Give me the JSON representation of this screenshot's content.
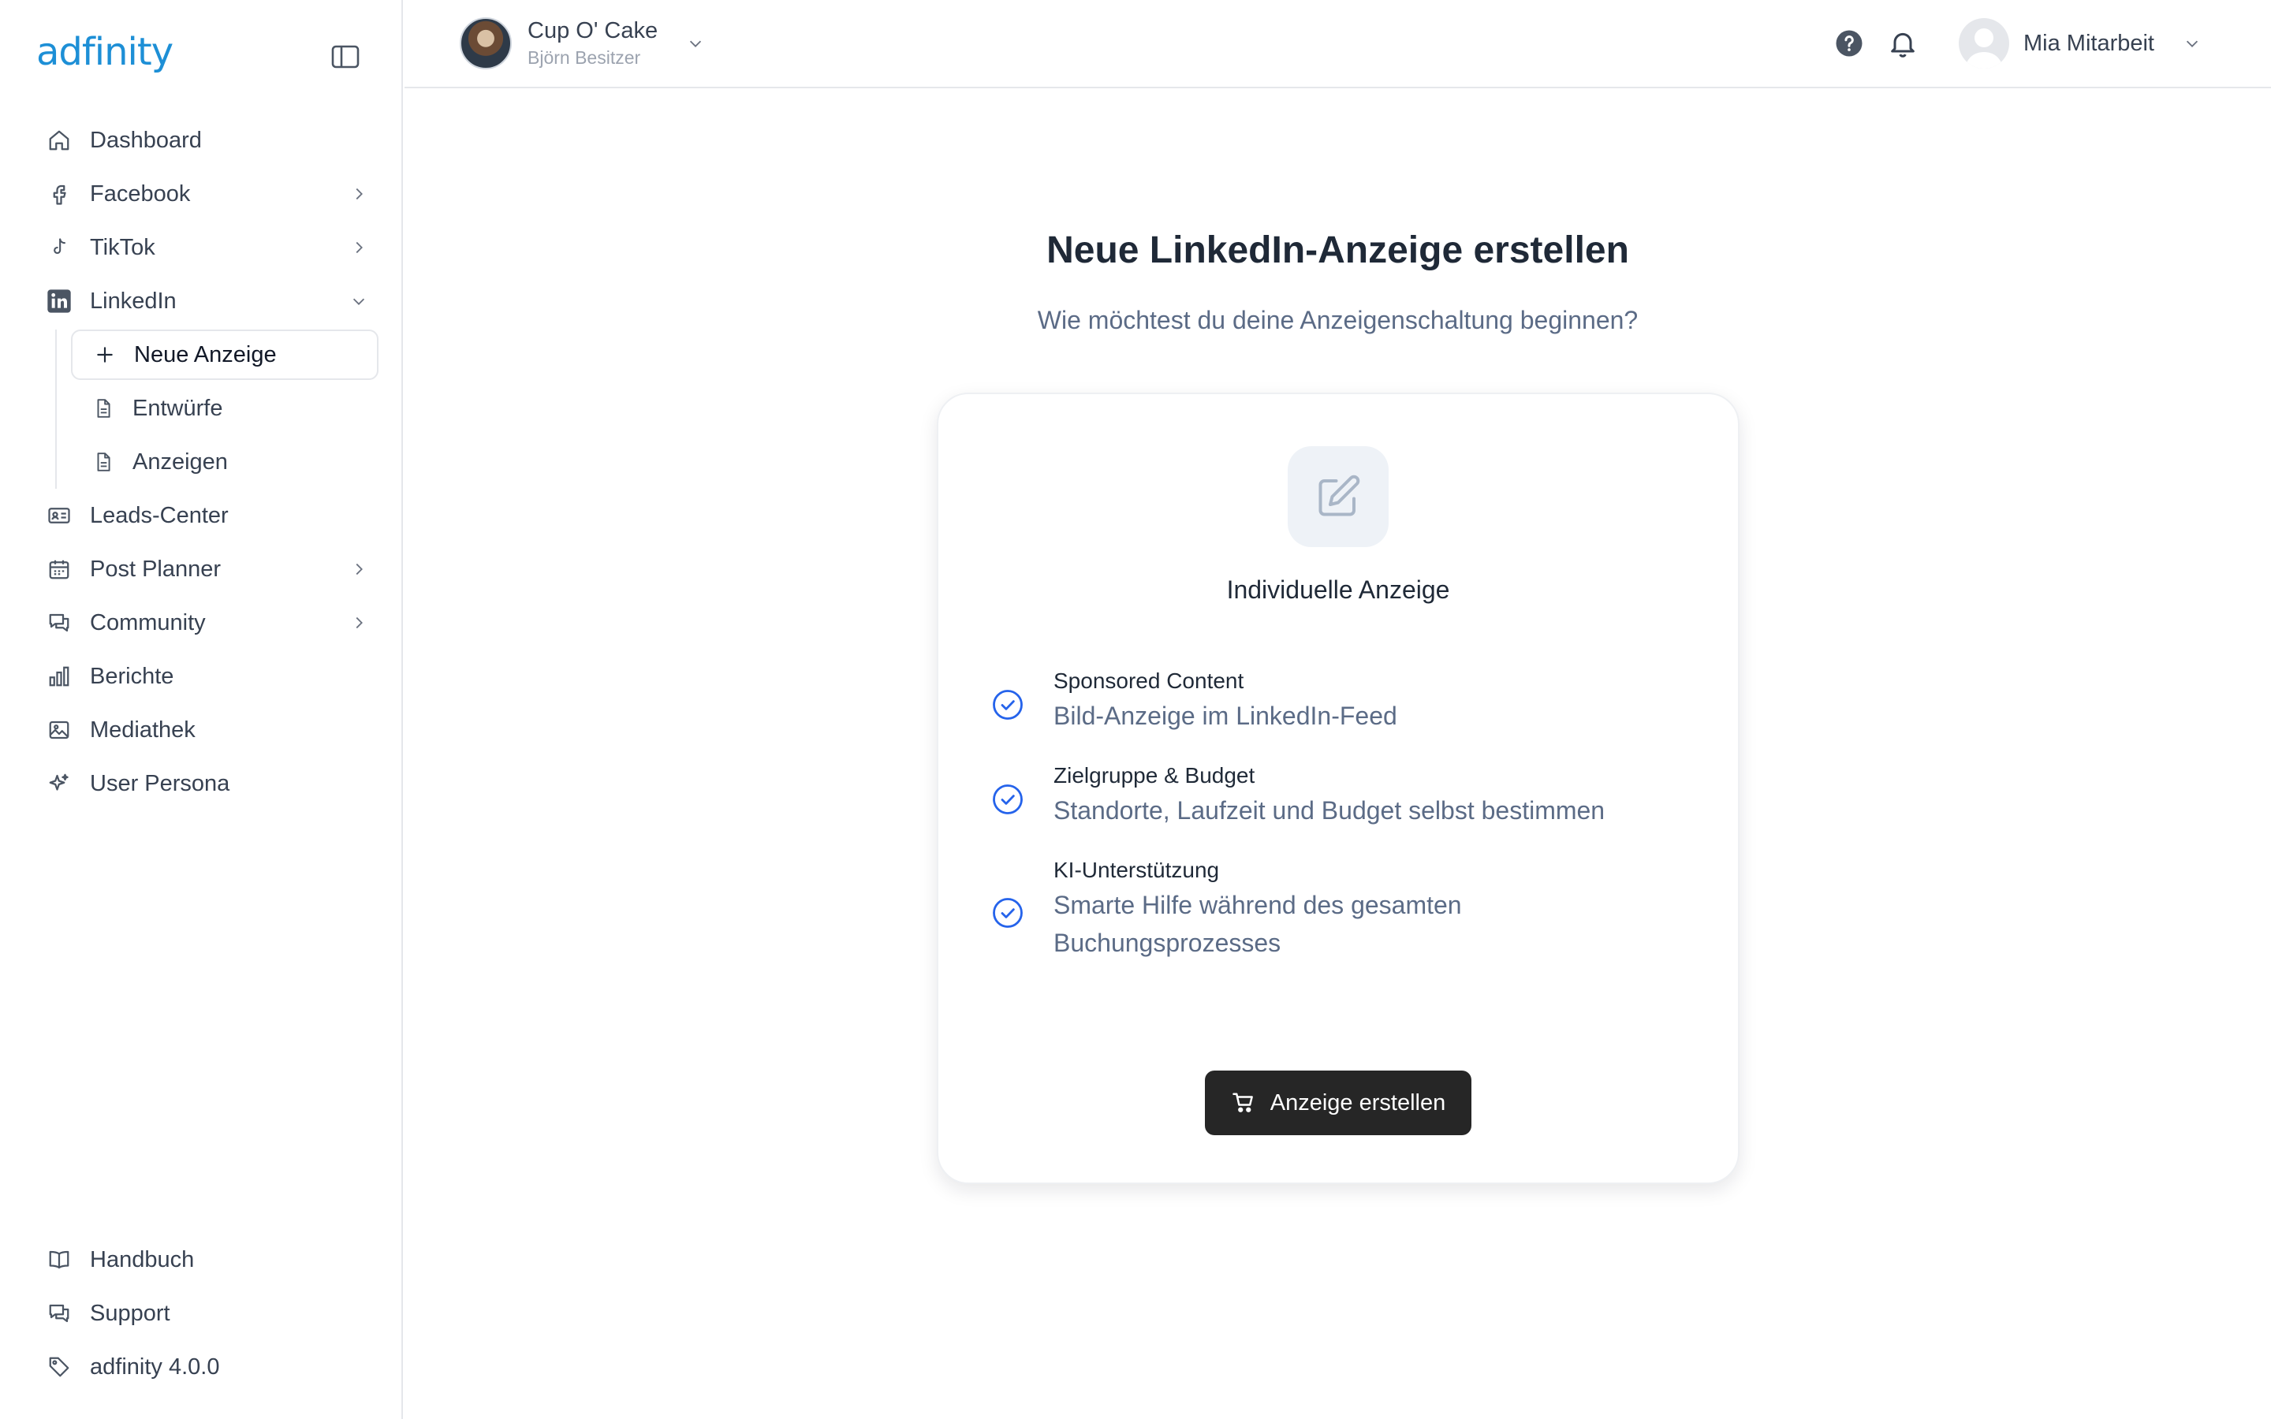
{
  "app": {
    "logo_text": "adfinity"
  },
  "sidebar": {
    "items": [
      {
        "label": "Dashboard",
        "icon": "home-icon"
      },
      {
        "label": "Facebook",
        "icon": "facebook-icon"
      },
      {
        "label": "TikTok",
        "icon": "tiktok-icon"
      },
      {
        "label": "LinkedIn",
        "icon": "linkedin-icon"
      },
      {
        "label": "Leads-Center",
        "icon": "contact-card-icon"
      },
      {
        "label": "Post Planner",
        "icon": "calendar-icon"
      },
      {
        "label": "Community",
        "icon": "chat-icon"
      },
      {
        "label": "Berichte",
        "icon": "bar-chart-icon"
      },
      {
        "label": "Mediathek",
        "icon": "image-icon"
      },
      {
        "label": "User Persona",
        "icon": "sparkles-icon"
      }
    ],
    "linkedin_sub": [
      {
        "label": "Neue Anzeige",
        "icon": "plus-icon",
        "active": true
      },
      {
        "label": "Entwürfe",
        "icon": "document-icon"
      },
      {
        "label": "Anzeigen",
        "icon": "document-icon"
      }
    ],
    "bottom": [
      {
        "label": "Handbuch",
        "icon": "book-icon"
      },
      {
        "label": "Support",
        "icon": "chat-icon"
      },
      {
        "label": "adfinity 4.0.0",
        "icon": "tag-icon"
      }
    ]
  },
  "topbar": {
    "business_name": "Cup O' Cake",
    "business_owner": "Björn Besitzer",
    "user_name": "Mia Mitarbeit"
  },
  "main": {
    "title": "Neue LinkedIn-Anzeige erstellen",
    "subtitle": "Wie möchtest du deine Anzeigenschaltung beginnen?",
    "card": {
      "title": "Individuelle Anzeige",
      "features": [
        {
          "title": "Sponsored Content",
          "desc": "Bild-Anzeige im LinkedIn-Feed"
        },
        {
          "title": "Zielgruppe & Budget",
          "desc": "Standorte, Laufzeit und Budget selbst bestimmen"
        },
        {
          "title": "KI-Unterstützung",
          "desc": "Smarte Hilfe während des gesamten Buchungsprozesses"
        }
      ],
      "button_label": "Anzeige erstellen"
    }
  },
  "colors": {
    "accent": "#2563eb",
    "logo": "#1d8fd6",
    "muted_text": "#5b6b86",
    "button_bg": "#262626"
  }
}
